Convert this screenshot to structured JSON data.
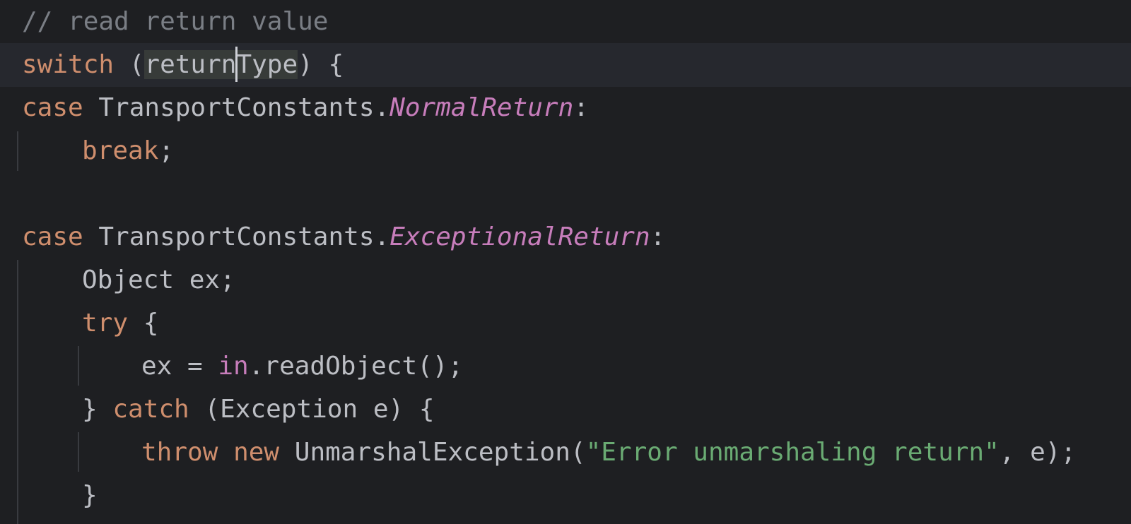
{
  "editor": {
    "lines": [
      {
        "comment": "// read return value"
      },
      {
        "kw": "switch",
        "open": " (",
        "hl_before_caret": "return",
        "hl_after_caret": "Type",
        "close": ") {"
      },
      {
        "kw": "case",
        "cls": " TransportConstants.",
        "field": "NormalReturn",
        "end": ":"
      },
      {
        "kw": "break",
        "end": ";"
      },
      {},
      {
        "kw": "case",
        "cls": " TransportConstants.",
        "field": "ExceptionalReturn",
        "end": ":"
      },
      {
        "text": "Object ex;"
      },
      {
        "kw": "try",
        "end": " {"
      },
      {
        "pre": "ex = ",
        "inkw": "in",
        "post": ".readObject();"
      },
      {
        "brace": "} ",
        "kw": "catch",
        "post": " (Exception e) {"
      },
      {
        "kw1": "throw",
        "sp": " ",
        "kw2": "new",
        "cls": " UnmarshalException(",
        "str": "\"Error unmarshaling return\"",
        "post": ", e);"
      },
      {
        "text": "}"
      }
    ]
  }
}
